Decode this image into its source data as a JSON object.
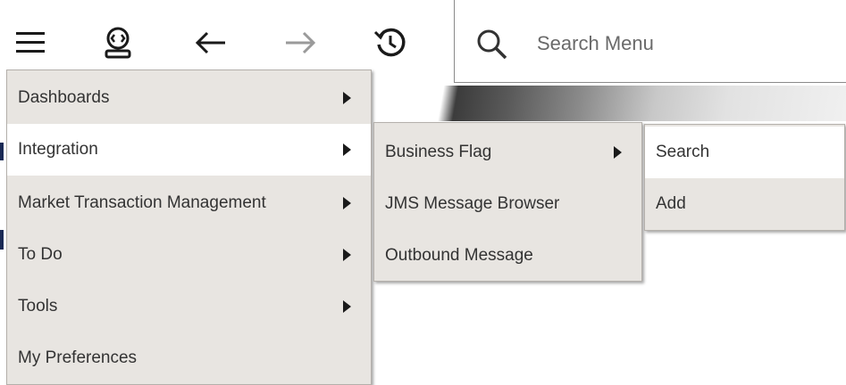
{
  "toolbar": {
    "icons": [
      "hamburger-icon",
      "user-badge-icon",
      "back-arrow-icon",
      "forward-arrow-icon",
      "history-icon"
    ]
  },
  "search": {
    "placeholder": "Search Menu",
    "icon": "search-icon"
  },
  "main_menu": {
    "items": [
      {
        "label": "Dashboards",
        "has_submenu": true
      },
      {
        "label": "Integration",
        "has_submenu": true,
        "active": true
      },
      {
        "label": "Market Transaction Management",
        "has_submenu": true
      },
      {
        "label": "To Do",
        "has_submenu": true
      },
      {
        "label": "Tools",
        "has_submenu": true
      },
      {
        "label": "My Preferences",
        "has_submenu": false
      }
    ]
  },
  "integration_menu": {
    "items": [
      {
        "label": "Business Flag",
        "has_submenu": true
      },
      {
        "label": "JMS Message Browser",
        "has_submenu": false
      },
      {
        "label": "Outbound Message",
        "has_submenu": false
      }
    ]
  },
  "business_flag_menu": {
    "items": [
      {
        "label": "Search",
        "active": true
      },
      {
        "label": "Add"
      }
    ]
  },
  "colors": {
    "menu_bg": "#e8e5e1",
    "menu_active_bg": "#ffffff",
    "text": "#333333",
    "icon": "#1a1a1a"
  }
}
